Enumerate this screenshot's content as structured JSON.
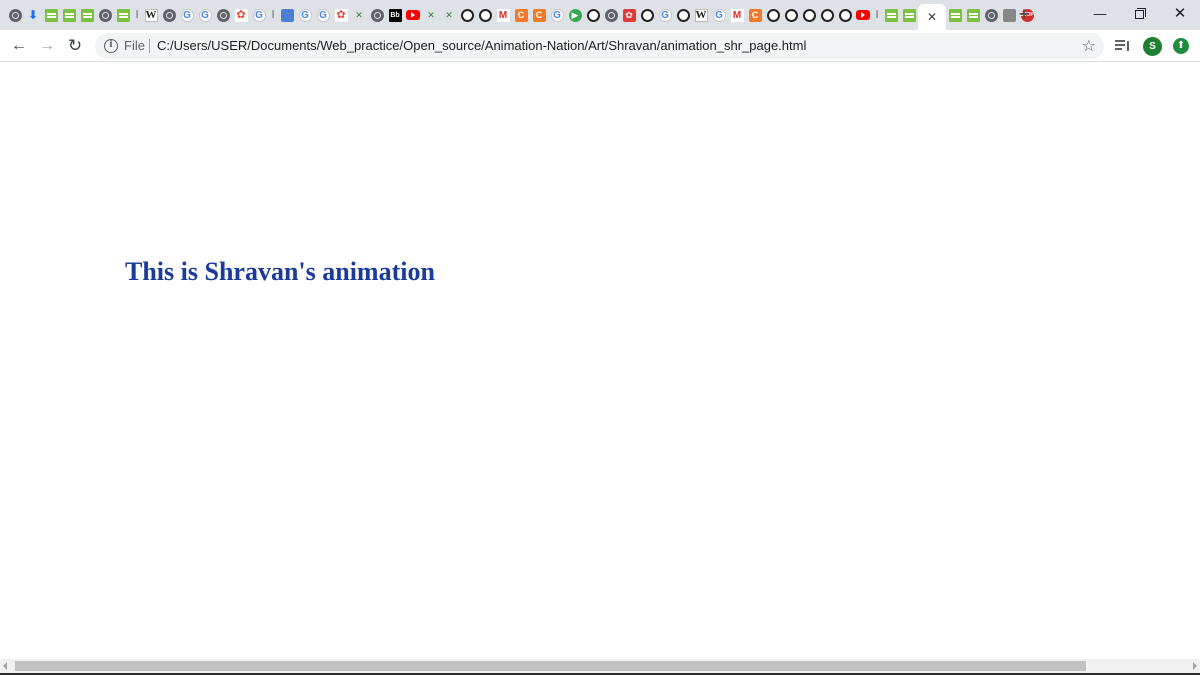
{
  "browser": {
    "tabs": [
      {
        "icon": "globe-icon",
        "glyph": ""
      },
      {
        "icon": "download-icon",
        "glyph": "⬇"
      },
      {
        "icon": "hackerrank-icon",
        "glyph": ""
      },
      {
        "icon": "hackerrank-icon",
        "glyph": ""
      },
      {
        "icon": "hackerrank-icon",
        "glyph": ""
      },
      {
        "icon": "globe-icon",
        "glyph": ""
      },
      {
        "icon": "hackerrank-icon",
        "glyph": ""
      },
      {
        "icon": "pinned-separator-icon",
        "glyph": "ǀ"
      },
      {
        "icon": "wikipedia-icon",
        "glyph": "W"
      },
      {
        "icon": "globe-icon",
        "glyph": ""
      },
      {
        "icon": "google-icon",
        "glyph": "G"
      },
      {
        "icon": "google-icon",
        "glyph": "G"
      },
      {
        "icon": "globe-icon",
        "glyph": ""
      },
      {
        "icon": "google-photos-icon",
        "glyph": "✿"
      },
      {
        "icon": "google-icon",
        "glyph": "G"
      },
      {
        "icon": "pinned-separator-icon",
        "glyph": "ǀ"
      },
      {
        "icon": "blue-app-icon",
        "glyph": ""
      },
      {
        "icon": "google-icon",
        "glyph": "G"
      },
      {
        "icon": "google-icon",
        "glyph": "G"
      },
      {
        "icon": "red-flower-icon",
        "glyph": "✿"
      },
      {
        "icon": "green-cross-icon",
        "glyph": "✕"
      },
      {
        "icon": "globe-icon",
        "glyph": ""
      },
      {
        "icon": "bb-icon",
        "glyph": "Bb"
      },
      {
        "icon": "youtube-icon",
        "glyph": ""
      },
      {
        "icon": "green-cross-icon",
        "glyph": "✕"
      },
      {
        "icon": "green-cross-icon",
        "glyph": "✕"
      },
      {
        "icon": "github-icon",
        "glyph": ""
      },
      {
        "icon": "github-icon",
        "glyph": ""
      },
      {
        "icon": "gmail-icon",
        "glyph": "M"
      },
      {
        "icon": "orange-c-icon",
        "glyph": "C"
      },
      {
        "icon": "orange-c-icon",
        "glyph": "C"
      },
      {
        "icon": "google-icon",
        "glyph": "G"
      },
      {
        "icon": "green-play-icon",
        "glyph": "▶"
      },
      {
        "icon": "github-icon",
        "glyph": ""
      },
      {
        "icon": "globe-icon",
        "glyph": ""
      },
      {
        "icon": "red-app-icon",
        "glyph": "✿"
      },
      {
        "icon": "github-icon",
        "glyph": ""
      },
      {
        "icon": "google-icon",
        "glyph": "G"
      },
      {
        "icon": "github-icon",
        "glyph": ""
      },
      {
        "icon": "wikipedia-icon",
        "glyph": "W"
      },
      {
        "icon": "google-icon",
        "glyph": "G"
      },
      {
        "icon": "gmail-icon",
        "glyph": "M"
      },
      {
        "icon": "orange-c-icon",
        "glyph": "C"
      },
      {
        "icon": "github-icon",
        "glyph": ""
      },
      {
        "icon": "github-icon",
        "glyph": ""
      },
      {
        "icon": "github-icon",
        "glyph": ""
      },
      {
        "icon": "github-icon",
        "glyph": ""
      },
      {
        "icon": "github-icon",
        "glyph": ""
      },
      {
        "icon": "youtube-icon",
        "glyph": ""
      },
      {
        "icon": "pinned-separator-icon",
        "glyph": "ǀ"
      },
      {
        "icon": "hackerrank-icon",
        "glyph": ""
      },
      {
        "icon": "hackerrank-icon",
        "glyph": ""
      }
    ],
    "tabs_after_active": [
      {
        "icon": "hackerrank-icon",
        "glyph": ""
      },
      {
        "icon": "hackerrank-icon",
        "glyph": ""
      },
      {
        "icon": "globe-icon",
        "glyph": ""
      },
      {
        "icon": "picture-icon",
        "glyph": ""
      },
      {
        "icon": "stop-icon",
        "glyph": "STOP"
      }
    ],
    "active_tab_close": "✕",
    "new_tab_label": "+",
    "window_controls": {
      "minimize": "—",
      "close": "✕"
    },
    "toolbar": {
      "back": "←",
      "forward": "→",
      "reload": "↻",
      "info": "i",
      "scheme": "File",
      "url": "C:/Users/USER/Documents/Web_practice/Open_source/Animation-Nation/Art/Shravan/animation_shr_page.html",
      "star": "☆",
      "avatar_letter": "S",
      "update": "⬆"
    },
    "colors": {
      "tabstrip": "#dee1e6",
      "accent_green": "#1e7e34",
      "heading": "#1a3a9c"
    }
  },
  "page": {
    "heading": "This is Shravan's animation"
  }
}
